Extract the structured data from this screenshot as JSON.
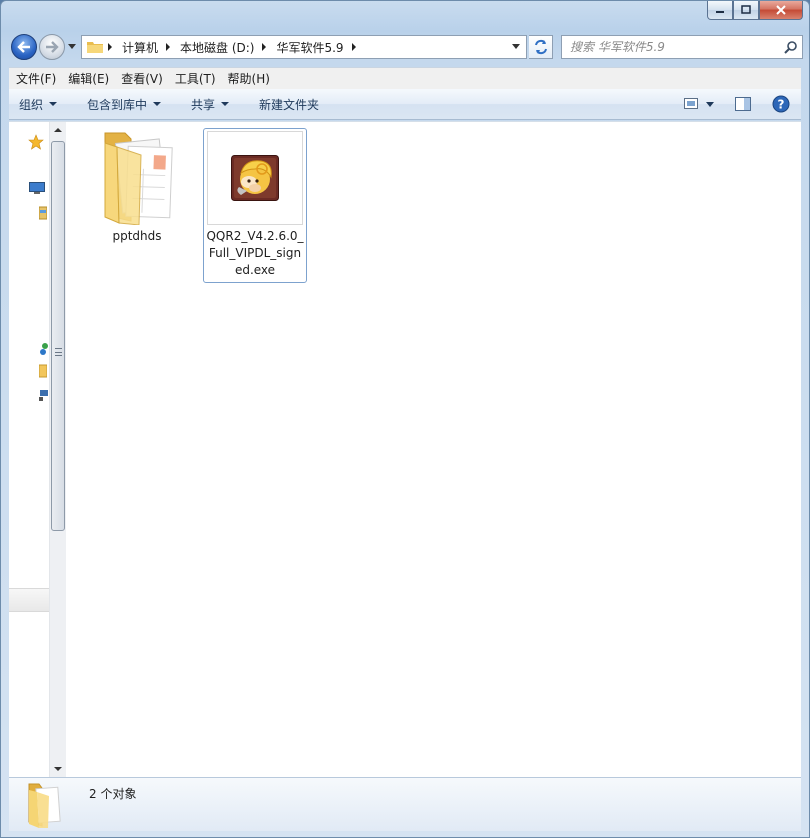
{
  "window": {
    "caption_icons": [
      "minimize-icon",
      "maximize-icon",
      "close-icon"
    ]
  },
  "address_bar": {
    "breadcrumbs": [
      "计算机",
      "本地磁盘 (D:)",
      "华军软件5.9"
    ]
  },
  "search": {
    "placeholder": "搜索 华军软件5.9"
  },
  "menu": {
    "items": [
      "文件(F)",
      "编辑(E)",
      "查看(V)",
      "工具(T)",
      "帮助(H)"
    ]
  },
  "toolbar": {
    "organize": "组织",
    "include_in_library": "包含到库中",
    "share": "共享",
    "new_folder": "新建文件夹"
  },
  "files": [
    {
      "name": "pptdhds",
      "type": "folder"
    },
    {
      "name": "QQR2_V4.2.6.0_Full_VIPDL_signed.exe",
      "type": "exe"
    }
  ],
  "status": {
    "count_text": "2 个对象"
  },
  "colors": {
    "accent": "#2a64c4",
    "selection_border": "#7da2ce",
    "folder": "#f2c65c"
  }
}
